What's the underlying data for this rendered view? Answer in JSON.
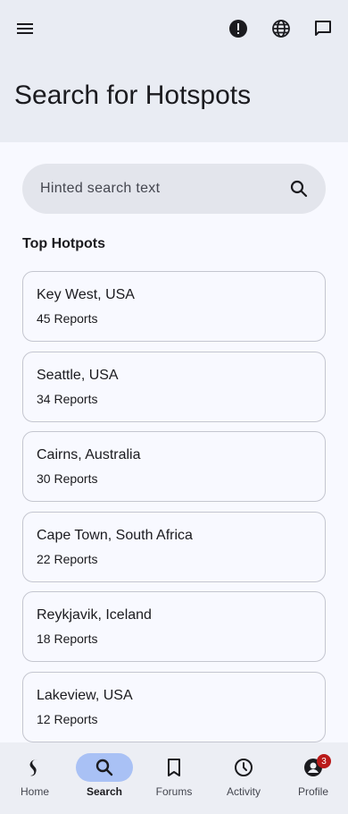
{
  "header": {
    "title": "Search for Hotspots",
    "menu_icon": "menu-icon",
    "actions": [
      "alert-icon",
      "globe-icon",
      "chat-icon"
    ]
  },
  "search": {
    "placeholder": "Hinted search text",
    "icon": "search-icon"
  },
  "section": {
    "title": "Top Hotpots"
  },
  "hotspots": [
    {
      "name": "Key West, USA",
      "reports": "45 Reports"
    },
    {
      "name": "Seattle, USA",
      "reports": "34 Reports"
    },
    {
      "name": "Cairns, Australia",
      "reports": "30 Reports"
    },
    {
      "name": "Cape Town, South Africa",
      "reports": "22 Reports"
    },
    {
      "name": "Reykjavik, Iceland",
      "reports": "18 Reports"
    },
    {
      "name": "Lakeview, USA",
      "reports": "12 Reports"
    }
  ],
  "nav": {
    "items": [
      {
        "label": "Home",
        "icon": "logo-icon"
      },
      {
        "label": "Search",
        "icon": "search-icon",
        "active": true
      },
      {
        "label": "Forums",
        "icon": "bookmark-icon"
      },
      {
        "label": "Activity",
        "icon": "history-icon"
      },
      {
        "label": "Profile",
        "icon": "account-icon",
        "badge": "3"
      }
    ]
  },
  "colors": {
    "header_bg": "#e9ecf3",
    "active_pill": "#a9c1f5",
    "badge": "#ba1a1a"
  }
}
